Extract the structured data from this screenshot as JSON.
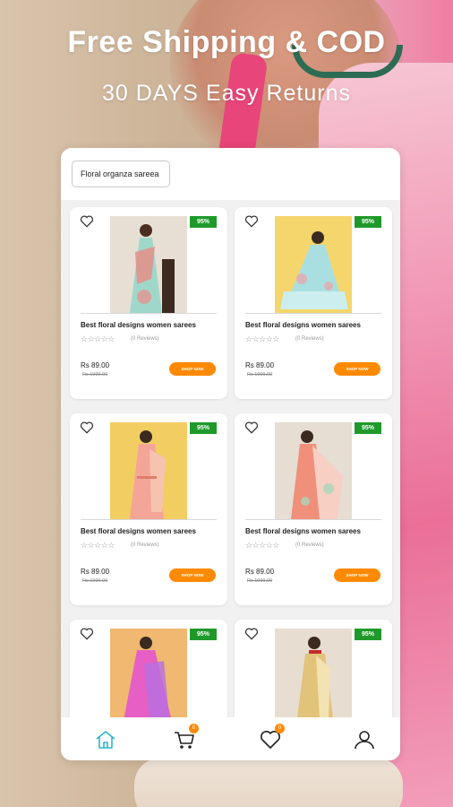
{
  "banner": {
    "headline": "Free Shipping & COD",
    "subheadline": "30 DAYS Easy Returns"
  },
  "search": {
    "value": "Floral organza sareea"
  },
  "products": [
    {
      "title": "Best floral designs women sarees",
      "discount": "95%",
      "reviews": "(0 Reviews)",
      "price": "Rs 89.00",
      "mrp": "Rs 1999.00",
      "cta": "SHOP NOW",
      "stars": "☆☆☆☆☆"
    },
    {
      "title": "Best floral designs women sarees",
      "discount": "95%",
      "reviews": "(0 Reviews)",
      "price": "Rs 89.00",
      "mrp": "Rs 1999.00",
      "cta": "SHOP NOW",
      "stars": "☆☆☆☆☆"
    },
    {
      "title": "Best floral designs women sarees",
      "discount": "95%",
      "reviews": "(0 Reviews)",
      "price": "Rs 89.00",
      "mrp": "Rs 1999.00",
      "cta": "SHOP NOW",
      "stars": "☆☆☆☆☆"
    },
    {
      "title": "Best floral designs women sarees",
      "discount": "95%",
      "reviews": "(0 Reviews)",
      "price": "Rs 89.00",
      "mrp": "Rs 1999.00",
      "cta": "SHOP NOW",
      "stars": "☆☆☆☆☆"
    },
    {
      "title": "",
      "discount": "95%"
    },
    {
      "title": "",
      "discount": "95%"
    }
  ],
  "nav": {
    "cart_count": "0",
    "wishlist_count": "0",
    "icons": [
      "home-icon",
      "cart-icon",
      "heart-icon",
      "profile-icon"
    ]
  },
  "colors": {
    "accent": "#ff8a00",
    "badge": "#1f9a2a",
    "home_active": "#2ab7c9"
  }
}
